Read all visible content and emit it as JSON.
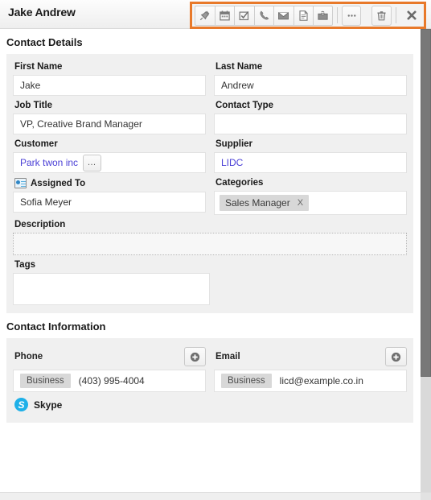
{
  "header": {
    "title": "Jake Andrew",
    "toolbar": {
      "buttons": [
        {
          "name": "pin-icon",
          "tooltip": "Pin"
        },
        {
          "name": "calendar-icon",
          "tooltip": "Appointment"
        },
        {
          "name": "task-check-icon",
          "tooltip": "Task"
        },
        {
          "name": "phone-icon",
          "tooltip": "Call"
        },
        {
          "name": "envelope-icon",
          "tooltip": "Email"
        },
        {
          "name": "document-icon",
          "tooltip": "Note"
        },
        {
          "name": "briefcase-icon",
          "tooltip": "Opportunity"
        }
      ],
      "more_label": "•••",
      "more_name": "more-options-icon",
      "delete_name": "trash-icon",
      "close_name": "close-icon",
      "highlight_color": "#e8792a"
    }
  },
  "sections": {
    "contact_details": {
      "title": "Contact Details",
      "fields": {
        "first_name": {
          "label": "First Name",
          "value": "Jake"
        },
        "last_name": {
          "label": "Last Name",
          "value": "Andrew"
        },
        "job_title": {
          "label": "Job Title",
          "value": "VP, Creative Brand Manager"
        },
        "contact_type": {
          "label": "Contact Type",
          "value": ""
        },
        "customer": {
          "label": "Customer",
          "value": "Park twon inc",
          "browse_label": "…"
        },
        "supplier": {
          "label": "Supplier",
          "value": "LIDC"
        },
        "assigned_to": {
          "label": "Assigned To",
          "value": "Sofia Meyer",
          "icon": "contact-card-icon"
        },
        "categories": {
          "label": "Categories",
          "tag": "Sales Manager",
          "tag_remove": "X"
        },
        "description": {
          "label": "Description",
          "value": ""
        },
        "tags": {
          "label": "Tags",
          "value": ""
        }
      }
    },
    "contact_information": {
      "title": "Contact Information",
      "phone": {
        "label": "Phone",
        "add_label": "+",
        "type_badge": "Business",
        "value": "(403) 995-4004"
      },
      "email": {
        "label": "Email",
        "add_label": "+",
        "type_badge": "Business",
        "value": "licd@example.co.in"
      },
      "skype": {
        "label": "Skype",
        "icon_letter": "S"
      }
    }
  }
}
